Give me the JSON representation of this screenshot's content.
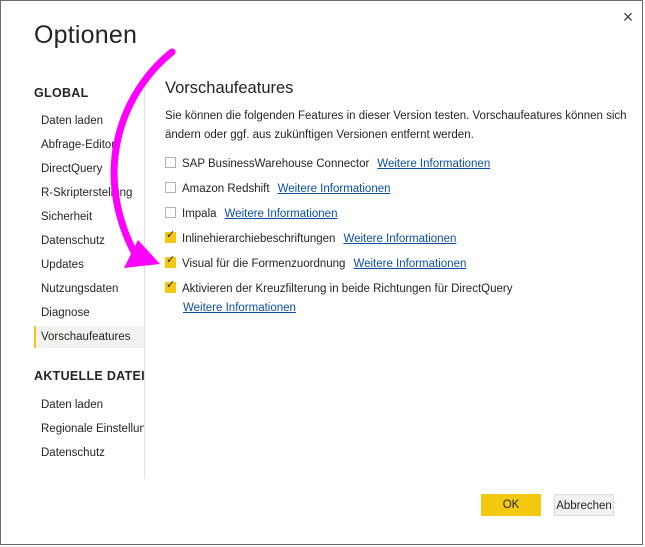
{
  "dialog": {
    "title": "Optionen",
    "close_glyph": "×"
  },
  "sidebar": {
    "global_heading": "GLOBAL",
    "global_items": [
      {
        "label": "Daten laden"
      },
      {
        "label": "Abfrage-Editor"
      },
      {
        "label": "DirectQuery"
      },
      {
        "label": "R-Skripterstellung"
      },
      {
        "label": "Sicherheit"
      },
      {
        "label": "Datenschutz"
      },
      {
        "label": "Updates"
      },
      {
        "label": "Nutzungsdaten"
      },
      {
        "label": "Diagnose"
      },
      {
        "label": "Vorschaufeatures",
        "active": true
      }
    ],
    "file_heading": "AKTUELLE DATEI",
    "file_items": [
      {
        "label": "Daten laden"
      },
      {
        "label": "Regionale Einstellungen"
      },
      {
        "label": "Datenschutz"
      }
    ]
  },
  "main": {
    "heading": "Vorschaufeatures",
    "description": "Sie können die folgenden Features in dieser Version testen. Vorschaufeatures können sich ändern oder ggf. aus zukünftigen Versionen entfernt werden.",
    "features": [
      {
        "label": "SAP BusinessWarehouse Connector",
        "checked": false,
        "link": "Weitere Informationen"
      },
      {
        "label": "Amazon Redshift",
        "checked": false,
        "link": "Weitere Informationen"
      },
      {
        "label": "Impala",
        "checked": false,
        "link": "Weitere Informationen"
      },
      {
        "label": "Inlinehierarchiebeschriftungen",
        "checked": true,
        "link": "Weitere Informationen"
      },
      {
        "label": "Visual für die Formenzuordnung",
        "checked": true,
        "link": "Weitere Informationen"
      },
      {
        "label": "Aktivieren der Kreuzfilterung in beide Richtungen für DirectQuery",
        "checked": true,
        "link": "Weitere Informationen"
      }
    ]
  },
  "buttons": {
    "ok": "OK",
    "cancel": "Abbrechen"
  },
  "colors": {
    "accent": "#f2c811",
    "link": "#0b4fa3",
    "annotation_arrow": "#ff00ff"
  }
}
